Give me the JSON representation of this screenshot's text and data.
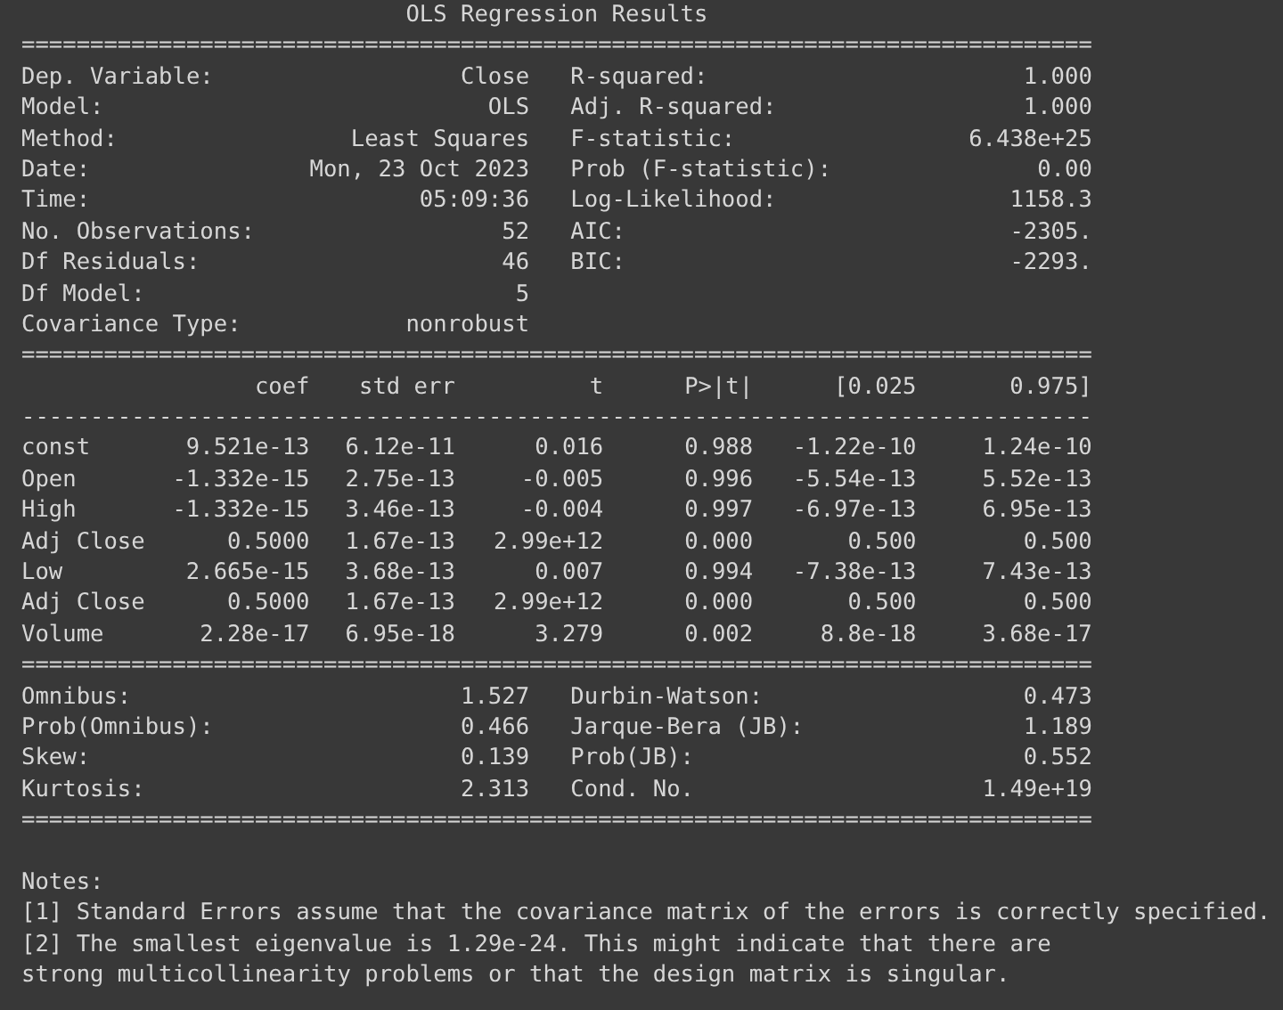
{
  "title": "OLS Regression Results",
  "model_info": {
    "rule_above": "==============================================================================",
    "rows": [
      {
        "label": "Dep. Variable:",
        "value": "Close",
        "label_2": "R-squared:",
        "value_2": "1.000"
      },
      {
        "label": "Model:",
        "value": "OLS",
        "label_2": "Adj. R-squared:",
        "value_2": "1.000"
      },
      {
        "label": "Method:",
        "value": "Least Squares",
        "label_2": "F-statistic:",
        "value_2": "6.438e+25"
      },
      {
        "label": "Date:",
        "value": "Mon, 23 Oct 2023",
        "label_2": "Prob (F-statistic):",
        "value_2": "0.00"
      },
      {
        "label": "Time:",
        "value": "05:09:36",
        "label_2": "Log-Likelihood:",
        "value_2": "1158.3"
      },
      {
        "label": "No. Observations:",
        "value": "52",
        "label_2": "AIC:",
        "value_2": "-2305."
      },
      {
        "label": "Df Residuals:",
        "value": "46",
        "label_2": "BIC:",
        "value_2": "-2293."
      },
      {
        "label": "Df Model:",
        "value": "5"
      },
      {
        "label": "Covariance Type:",
        "value": "nonrobust"
      }
    ]
  },
  "coefficients": {
    "rule_above": "==============================================================================",
    "columns": [
      "coef",
      "std err",
      "t",
      "P>|t|",
      "[0.025",
      "0.975]"
    ],
    "rule_below_header": "------------------------------------------------------------------------------",
    "rows": [
      {
        "name": "const",
        "values": [
          "9.521e-13",
          "6.12e-11",
          "0.016",
          "0.988",
          "-1.22e-10",
          "1.24e-10"
        ]
      },
      {
        "name": "Open",
        "values": [
          "-1.332e-15",
          "2.75e-13",
          "-0.005",
          "0.996",
          "-5.54e-13",
          "5.52e-13"
        ]
      },
      {
        "name": "High",
        "values": [
          "-1.332e-15",
          "3.46e-13",
          "-0.004",
          "0.997",
          "-6.97e-13",
          "6.95e-13"
        ]
      },
      {
        "name": "Adj Close",
        "values": [
          "0.5000",
          "1.67e-13",
          "2.99e+12",
          "0.000",
          "0.500",
          "0.500"
        ]
      },
      {
        "name": "Low",
        "values": [
          "2.665e-15",
          "3.68e-13",
          "0.007",
          "0.994",
          "-7.38e-13",
          "7.43e-13"
        ]
      },
      {
        "name": "Adj Close",
        "values": [
          "0.5000",
          "1.67e-13",
          "2.99e+12",
          "0.000",
          "0.500",
          "0.500"
        ]
      },
      {
        "name": "Volume",
        "values": [
          "2.28e-17",
          "6.95e-18",
          "3.279",
          "0.002",
          "8.8e-18",
          "3.68e-17"
        ]
      }
    ]
  },
  "diagnostics": {
    "rule_above": "==============================================================================",
    "rows": [
      {
        "label": "Omnibus:",
        "value": "1.527",
        "label_2": "Durbin-Watson:",
        "value_2": "0.473"
      },
      {
        "label": "Prob(Omnibus):",
        "value": "0.466",
        "label_2": "Jarque-Bera (JB):",
        "value_2": "1.189"
      },
      {
        "label": "Skew:",
        "value": "0.139",
        "label_2": "Prob(JB):",
        "value_2": "0.552"
      },
      {
        "label": "Kurtosis:",
        "value": "2.313",
        "label_2": "Cond. No.",
        "value_2": "1.49e+19"
      }
    ],
    "rule_below": "=============================================================================="
  },
  "notes": {
    "title": "Notes:",
    "lines": [
      "[1] Standard Errors assume that the covariance matrix of the errors is correctly specified.",
      "[2] The smallest eigenvalue is 1.29e-24. This might indicate that there are",
      "strong multicollinearity problems or that the design matrix is singular."
    ]
  }
}
